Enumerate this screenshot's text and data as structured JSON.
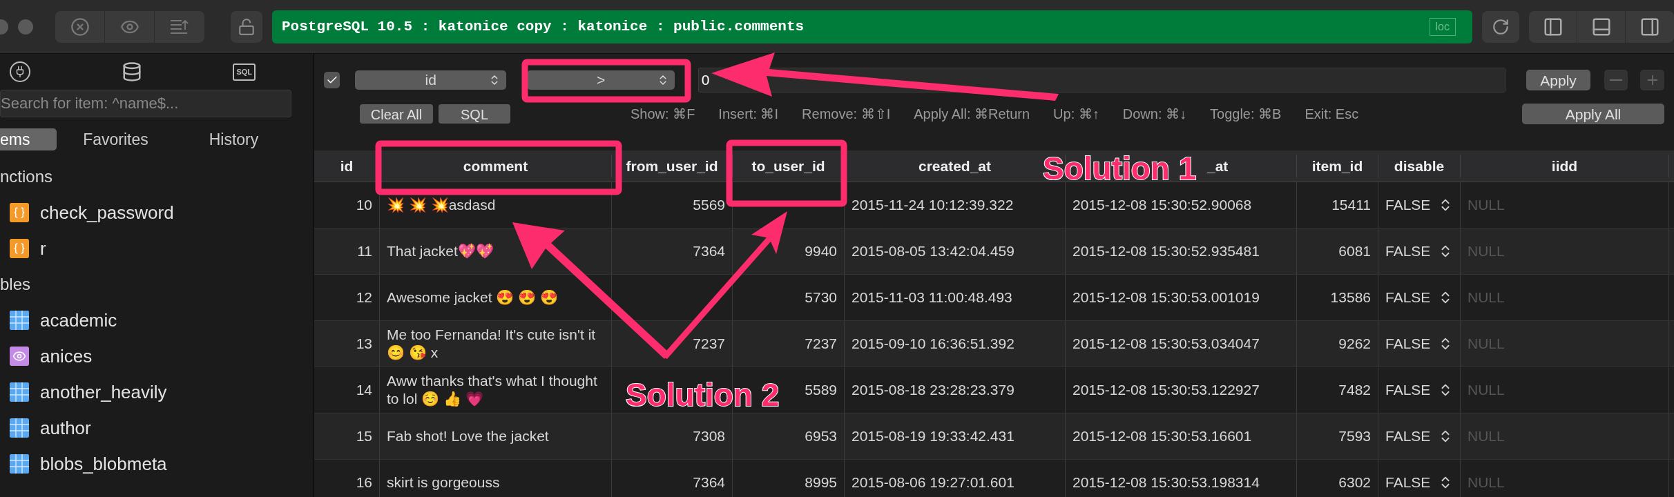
{
  "toolbar": {
    "connection": "PostgreSQL 10.5 : katonice copy : katonice : public.comments",
    "badge": "loc"
  },
  "sidebar": {
    "sql_icon_label": "SQL",
    "search": {
      "placeholder": "Search for item: ^name$..."
    },
    "tabs": [
      {
        "label": "ems",
        "selected": true
      },
      {
        "label": "Favorites",
        "selected": false
      },
      {
        "label": "History",
        "selected": false
      }
    ],
    "sections": [
      {
        "title": "nctions",
        "items": [
          {
            "name": "check_password",
            "kind": "function"
          },
          {
            "name": "r",
            "kind": "function"
          }
        ]
      },
      {
        "title": "bles",
        "items": [
          {
            "name": "academic",
            "kind": "table"
          },
          {
            "name": "anices",
            "kind": "view"
          },
          {
            "name": "another_heavily",
            "kind": "table"
          },
          {
            "name": "author",
            "kind": "table"
          },
          {
            "name": "blobs_blobmeta",
            "kind": "table"
          }
        ]
      }
    ]
  },
  "filter": {
    "enabled": true,
    "column": "id",
    "operator": ">",
    "value": "0",
    "apply": "Apply",
    "clear_all": "Clear All",
    "sql": "SQL",
    "apply_all": "Apply All",
    "shortcuts": [
      "Show: ⌘F",
      "Insert: ⌘I",
      "Remove: ⌘⇧I",
      "Apply All: ⌘Return",
      "Up: ⌘↑",
      "Down: ⌘↓",
      "Toggle: ⌘B",
      "Exit: Esc"
    ]
  },
  "table": {
    "columns": [
      "id",
      "comment",
      "from_user_id",
      "to_user_id",
      "created_at",
      "_at",
      "item_id",
      "disable",
      "iidd"
    ],
    "rows": [
      {
        "cells": [
          "10",
          "💥 💥 💥asdasd",
          "5569",
          null,
          "2015-11-24 10:12:39.322",
          "2015-12-08 15:30:52.90068",
          "15411",
          "FALSE",
          "NULL"
        ]
      },
      {
        "cells": [
          "11",
          "That jacket💖💖",
          "7364",
          "9940",
          "2015-08-05 13:42:04.459",
          "2015-12-08 15:30:52.935481",
          "6081",
          "FALSE",
          "NULL"
        ]
      },
      {
        "cells": [
          "12",
          "Awesome jacket 😍 😍 😍",
          null,
          "5730",
          "2015-11-03 11:00:48.493",
          "2015-12-08 15:30:53.001019",
          "13586",
          "FALSE",
          "NULL"
        ]
      },
      {
        "cells": [
          "13",
          "Me too Fernanda! It's cute isn't it 😊 😘  x",
          "7237",
          "7237",
          "2015-09-10 16:36:51.392",
          "2015-12-08 15:30:53.034047",
          "9262",
          "FALSE",
          "NULL"
        ]
      },
      {
        "cells": [
          "14",
          "Aww thanks that's what I thought to lol ☺️ 👍 💗",
          null,
          "5589",
          "2015-08-18 23:28:23.379",
          "2015-12-08 15:30:53.122927",
          "7482",
          "FALSE",
          "NULL"
        ]
      },
      {
        "cells": [
          "15",
          "Fab shot! Love the jacket",
          "7308",
          "6953",
          "2015-08-19 19:33:42.431",
          "2015-12-08 15:30:53.16601",
          "7593",
          "FALSE",
          "NULL"
        ]
      },
      {
        "cells": [
          "16",
          "skirt is gorgeouss",
          "7364",
          "8995",
          "2015-08-06 19:27:01.601",
          "2015-12-08 15:30:53.198314",
          "6302",
          "FALSE",
          "NULL"
        ]
      }
    ]
  },
  "annotations": {
    "labels": [
      "Solution 1",
      "Solution 2"
    ]
  }
}
